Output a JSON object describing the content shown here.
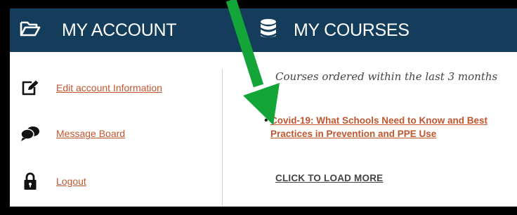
{
  "header": {
    "account_label": "MY ACCOUNT",
    "courses_label": "MY COURSES",
    "account_icon": "folder-open-icon",
    "courses_icon": "database-icon",
    "background_color": "#143d5c"
  },
  "account_menu": {
    "items": [
      {
        "label": "Edit account Information",
        "icon": "edit-icon"
      },
      {
        "label": "Message Board",
        "icon": "comments-icon"
      },
      {
        "label": "Logout",
        "icon": "lock-icon"
      }
    ],
    "link_color": "#c0562f"
  },
  "courses": {
    "intro": "Courses ordered within the last 3 months",
    "list": [
      {
        "title": "Covid-19: What Schools Need to Know and Best Practices in Prevention and PPE Use"
      }
    ],
    "load_more": "CLICK TO LOAD MORE"
  },
  "annotation": {
    "arrow_color": "#13a538",
    "arrow_icon": "green-arrow-annotation"
  }
}
